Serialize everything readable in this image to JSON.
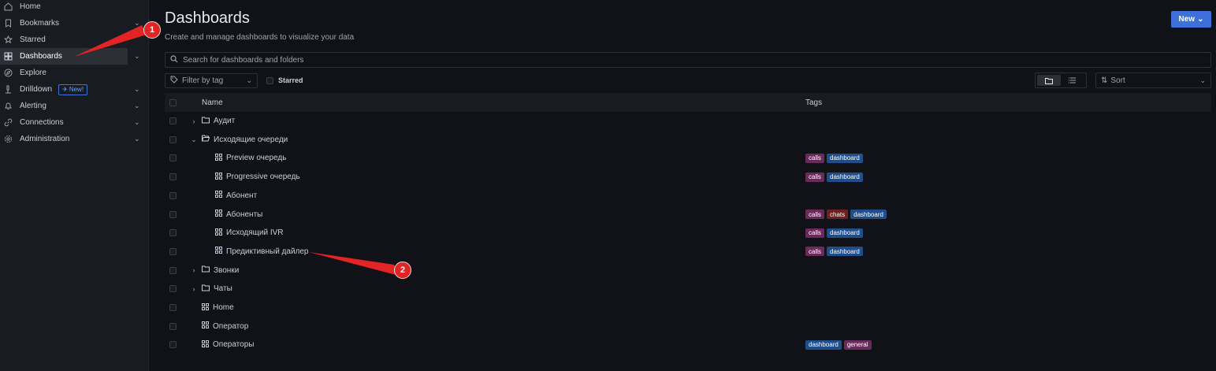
{
  "sidebar": {
    "items": [
      {
        "label": "Home",
        "icon": "home-icon",
        "chevron": false
      },
      {
        "label": "Bookmarks",
        "icon": "bookmark-icon",
        "chevron": true
      },
      {
        "label": "Starred",
        "icon": "star-icon",
        "chevron": false
      },
      {
        "label": "Dashboards",
        "icon": "dashboard-grid-icon",
        "chevron": true,
        "active": true
      },
      {
        "label": "Explore",
        "icon": "compass-icon",
        "chevron": false
      },
      {
        "label": "Drilldown",
        "icon": "microscope-icon",
        "chevron": true,
        "badge": "New!"
      },
      {
        "label": "Alerting",
        "icon": "bell-icon",
        "chevron": true
      },
      {
        "label": "Connections",
        "icon": "link-icon",
        "chevron": true
      },
      {
        "label": "Administration",
        "icon": "gear-icon",
        "chevron": true
      }
    ]
  },
  "header": {
    "title": "Dashboards",
    "subtitle": "Create and manage dashboards to visualize your data",
    "new_button": "New"
  },
  "search": {
    "placeholder": "Search for dashboards and folders"
  },
  "filters": {
    "tag_placeholder": "Filter by tag",
    "starred_label": "Starred",
    "sort_label": "Sort"
  },
  "table": {
    "col_name": "Name",
    "col_tags": "Tags",
    "rows": [
      {
        "name": "Аудит",
        "type": "folder",
        "depth": 0,
        "expander": "›",
        "tags": []
      },
      {
        "name": "Исходящие очереди",
        "type": "folder-open",
        "depth": 0,
        "expander": "⌄",
        "tags": []
      },
      {
        "name": "Preview очередь",
        "type": "dashboard",
        "depth": 1,
        "tags": [
          "calls",
          "dashboard"
        ]
      },
      {
        "name": "Progressive очередь",
        "type": "dashboard",
        "depth": 1,
        "tags": [
          "calls",
          "dashboard"
        ]
      },
      {
        "name": "Абонент",
        "type": "dashboard",
        "depth": 1,
        "tags": []
      },
      {
        "name": "Абоненты",
        "type": "dashboard",
        "depth": 1,
        "tags": [
          "calls",
          "chats",
          "dashboard"
        ]
      },
      {
        "name": "Исходящий IVR",
        "type": "dashboard",
        "depth": 1,
        "tags": [
          "calls",
          "dashboard"
        ]
      },
      {
        "name": "Предиктивный дайлер",
        "type": "dashboard",
        "depth": 1,
        "tags": [
          "calls",
          "dashboard"
        ]
      },
      {
        "name": "Звонки",
        "type": "folder",
        "depth": 0,
        "expander": "›",
        "tags": []
      },
      {
        "name": "Чаты",
        "type": "folder",
        "depth": 0,
        "expander": "›",
        "tags": []
      },
      {
        "name": "Home",
        "type": "dashboard",
        "depth": 0,
        "tags": []
      },
      {
        "name": "Оператор",
        "type": "dashboard",
        "depth": 0,
        "tags": []
      },
      {
        "name": "Операторы",
        "type": "dashboard",
        "depth": 0,
        "tags": [
          "dashboard",
          "general"
        ]
      }
    ]
  },
  "tag_colors": {
    "calls": "#6b2a5c",
    "dashboard": "#1f4e8c",
    "chats": "#6e1f1f",
    "general": "#6b2a5c"
  },
  "annotations": [
    {
      "label": "1"
    },
    {
      "label": "2"
    }
  ]
}
